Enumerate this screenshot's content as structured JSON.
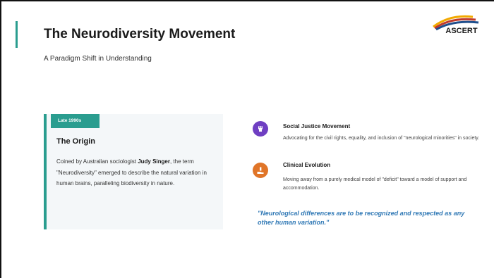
{
  "slide": {
    "title": "The Neurodiversity Movement",
    "subtitle": "A Paradigm Shift in Understanding"
  },
  "logo": {
    "text": "ASCERT",
    "colors": [
      "#f2a900",
      "#c0392b",
      "#1f4e8c"
    ]
  },
  "origin_card": {
    "badge": "Late 1990s",
    "heading": "The Origin",
    "body_before": "Coined by Australian sociologist ",
    "body_emphasis": "Judy Singer",
    "body_after": ", the term \"Neurodiversity\" emerged to describe the natural variation in human brains, paralleling biodiversity in nature."
  },
  "items": [
    {
      "title": "Social Justice Movement",
      "description": "Advocating for the civil rights, equality, and inclusion of \"neurological minorities\" in society.",
      "icon": "raised-fist-icon",
      "color": "#6f3fc2"
    },
    {
      "title": "Clinical Evolution",
      "description": "Moving away from a purely medical model of \"deficit\" toward a model of support and accommodation.",
      "icon": "hand-holding-icon",
      "color": "#e07528"
    }
  ],
  "quote": "\"Neurological differences are to be recognized and respected as any other human variation.\"",
  "colors": {
    "accent": "#2a9d8f",
    "quote": "#2f78b5",
    "card_bg": "#f4f7f9"
  }
}
